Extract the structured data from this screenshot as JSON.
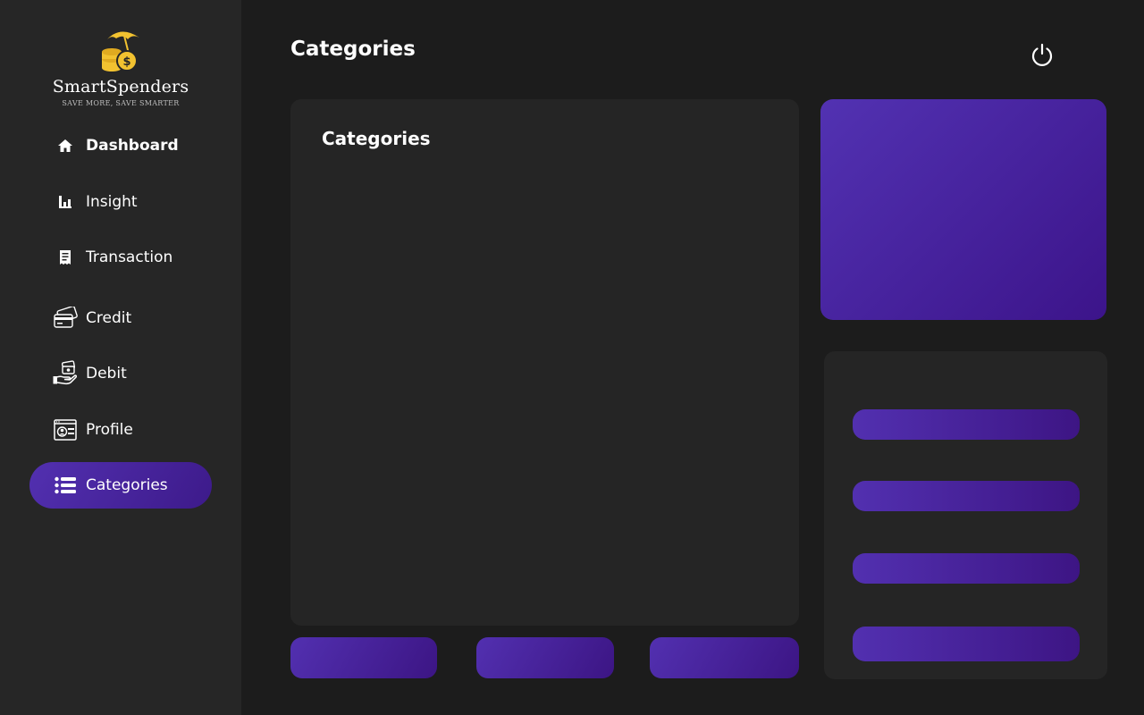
{
  "app": {
    "name": "SmartSpenders",
    "tagline": "SAVE MORE, SAVE SMARTER"
  },
  "sidebar": {
    "items": [
      {
        "label": "Dashboard",
        "icon": "home-icon"
      },
      {
        "label": "Insight",
        "icon": "bar-chart-icon"
      },
      {
        "label": "Transaction",
        "icon": "receipt-icon"
      },
      {
        "label": "Credit",
        "icon": "credit-card-icon"
      },
      {
        "label": "Debit",
        "icon": "hand-money-icon"
      },
      {
        "label": "Profile",
        "icon": "profile-card-icon"
      },
      {
        "label": "Categories",
        "icon": "list-icon",
        "active": true
      }
    ]
  },
  "header": {
    "title": "Categories",
    "logout_icon": "power-icon"
  },
  "main": {
    "card_title": "Categories"
  },
  "colors": {
    "accent": "#4a28a8",
    "accent_dark": "#3c148a",
    "background": "#1c1c1c",
    "sidebar": "#262626",
    "card": "#252525",
    "logo_gold": "#f2c230"
  }
}
